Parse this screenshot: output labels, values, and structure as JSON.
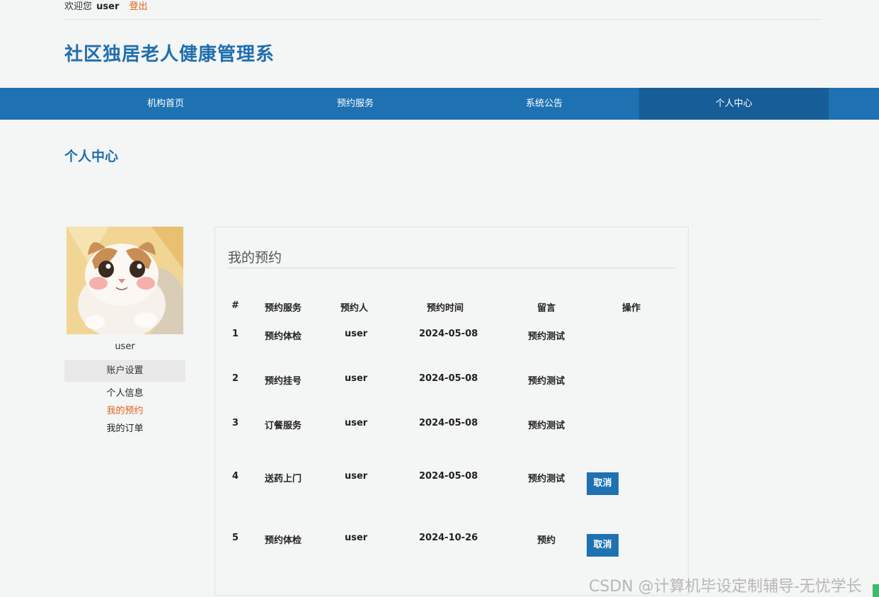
{
  "header": {
    "welcome": "欢迎您",
    "username": "user",
    "logout": "登出",
    "site_title": "社区独居老人健康管理系"
  },
  "nav": {
    "items": [
      {
        "label": "机构首页"
      },
      {
        "label": "预约服务"
      },
      {
        "label": "系统公告"
      },
      {
        "label": "个人中心"
      }
    ],
    "active_index": 3
  },
  "page": {
    "section_title": "个人中心"
  },
  "sidebar": {
    "avatar_icon": "cat-photo-icon",
    "username": "user",
    "heading": "账户设置",
    "links": [
      {
        "label": "个人信息"
      },
      {
        "label": "我的预约"
      },
      {
        "label": "我的订单"
      }
    ],
    "active_link": 1
  },
  "appointments": {
    "title": "我的预约",
    "columns": [
      "#",
      "预约服务",
      "预约人",
      "预约时间",
      "留言",
      "操作"
    ],
    "rows": [
      {
        "id": "1",
        "service": "预约体检",
        "person": "user",
        "time": "2024-05-08",
        "note": "预约测试",
        "action": ""
      },
      {
        "id": "2",
        "service": "预约挂号",
        "person": "user",
        "time": "2024-05-08",
        "note": "预约测试",
        "action": ""
      },
      {
        "id": "3",
        "service": "订餐服务",
        "person": "user",
        "time": "2024-05-08",
        "note": "预约测试",
        "action": ""
      },
      {
        "id": "4",
        "service": "送药上门",
        "person": "user",
        "time": "2024-05-08",
        "note": "预约测试",
        "action": "取消"
      },
      {
        "id": "5",
        "service": "预约体检",
        "person": "user",
        "time": "2024-10-26",
        "note": "预约",
        "action": "取消"
      }
    ]
  },
  "watermark": "CSDN @计算机毕设定制辅导-无忧学长",
  "colors": {
    "primary": "#1e72b2",
    "nav_active": "#175e99",
    "accent": "#e0631a",
    "title": "#1e6fae"
  }
}
